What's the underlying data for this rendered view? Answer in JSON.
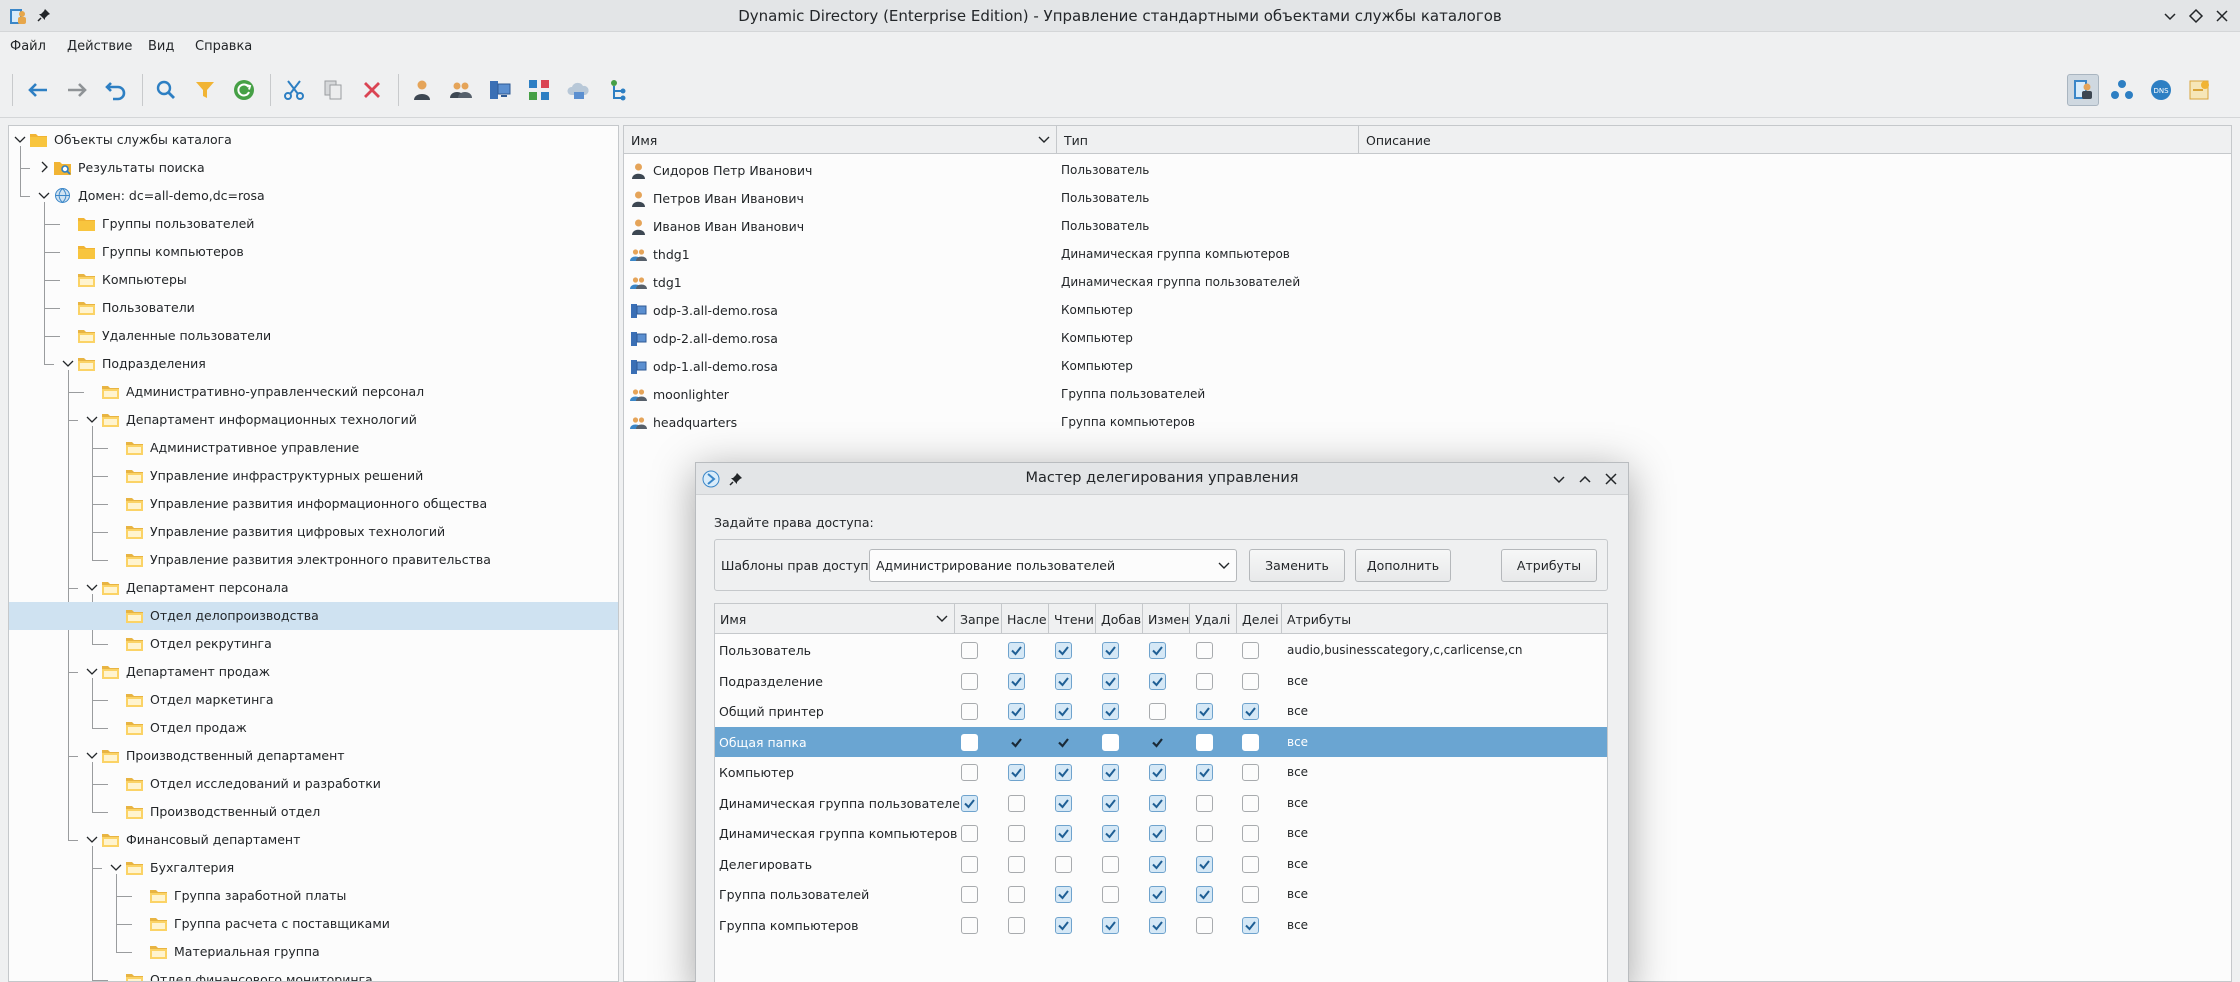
{
  "window": {
    "title": "Dynamic Directory (Enterprise Edition) - Управление стандартными объектами службы каталогов"
  },
  "menu": [
    "Файл",
    "Действие",
    "Вид",
    "Справка"
  ],
  "toolbar": {
    "left": [
      "back-arrow-icon",
      "forward-arrow-icon",
      "undo-icon",
      "search-icon",
      "filter-icon",
      "refresh-icon",
      "cut-icon",
      "copy-icon",
      "delete-icon",
      "user-icon",
      "group-icon",
      "computer-icon",
      "ou-icon",
      "cloud-icon",
      "tree-icon"
    ],
    "right": [
      "directory-view-icon",
      "network-icon",
      "dns-icon",
      "policy-icon"
    ],
    "accent": "#2d7fc3"
  },
  "tree": {
    "items": [
      {
        "label": "Объекты службы каталога",
        "level": 0,
        "expanded": true,
        "icon": "folder"
      },
      {
        "label": "Результаты поиска",
        "level": 1,
        "expanded": false,
        "icon": "search-folder"
      },
      {
        "label": "Домен: dc=all-demo,dc=rosa",
        "level": 1,
        "expanded": true,
        "icon": "domain"
      },
      {
        "label": "Группы пользователей",
        "level": 2,
        "icon": "folder"
      },
      {
        "label": "Группы компьютеров",
        "level": 2,
        "icon": "folder"
      },
      {
        "label": "Компьютеры",
        "level": 2,
        "icon": "ou"
      },
      {
        "label": "Пользователи",
        "level": 2,
        "icon": "ou"
      },
      {
        "label": "Удаленные пользователи",
        "level": 2,
        "icon": "ou"
      },
      {
        "label": "Подразделения",
        "level": 2,
        "expanded": true,
        "icon": "ou"
      },
      {
        "label": "Административно-управленческий персонал",
        "level": 3,
        "icon": "ou"
      },
      {
        "label": "Департамент информационных технологий",
        "level": 3,
        "expanded": true,
        "icon": "ou"
      },
      {
        "label": "Административное управление",
        "level": 4,
        "icon": "ou"
      },
      {
        "label": "Управление инфраструктурных решений",
        "level": 4,
        "icon": "ou"
      },
      {
        "label": "Управление развития информационного общества",
        "level": 4,
        "icon": "ou"
      },
      {
        "label": "Управление развития цифровых технологий",
        "level": 4,
        "icon": "ou"
      },
      {
        "label": "Управление развития электронного правительства",
        "level": 4,
        "icon": "ou"
      },
      {
        "label": "Департамент персонала",
        "level": 3,
        "expanded": true,
        "icon": "ou"
      },
      {
        "label": "Отдел делопроизводства",
        "level": 4,
        "icon": "ou",
        "selected": true
      },
      {
        "label": "Отдел рекрутинга",
        "level": 4,
        "icon": "ou"
      },
      {
        "label": "Департамент продаж",
        "level": 3,
        "expanded": true,
        "icon": "ou"
      },
      {
        "label": "Отдел маркетинга",
        "level": 4,
        "icon": "ou"
      },
      {
        "label": "Отдел продаж",
        "level": 4,
        "icon": "ou"
      },
      {
        "label": "Производственный департамент",
        "level": 3,
        "expanded": true,
        "icon": "ou"
      },
      {
        "label": "Отдел исследований и разработки",
        "level": 4,
        "icon": "ou"
      },
      {
        "label": "Производственный отдел",
        "level": 4,
        "icon": "ou"
      },
      {
        "label": "Финансовый департамент",
        "level": 3,
        "expanded": true,
        "icon": "ou"
      },
      {
        "label": "Бухгалтерия",
        "level": 4,
        "expanded": true,
        "icon": "ou"
      },
      {
        "label": "Группа заработной платы",
        "level": 5,
        "icon": "ou"
      },
      {
        "label": "Группа расчета с поставщиками",
        "level": 5,
        "icon": "ou"
      },
      {
        "label": "Материальная группа",
        "level": 5,
        "icon": "ou"
      },
      {
        "label": "Отдел финансового мониторинга",
        "level": 4,
        "icon": "ou"
      }
    ]
  },
  "list": {
    "columns": [
      "Имя",
      "Тип",
      "Описание"
    ],
    "rows": [
      {
        "name": "Сидоров Петр Иванович",
        "type": "Пользователь",
        "icon": "user"
      },
      {
        "name": "Петров Иван Иванович",
        "type": "Пользователь",
        "icon": "user"
      },
      {
        "name": "Иванов Иван Иванович",
        "type": "Пользователь",
        "icon": "user"
      },
      {
        "name": "thdg1",
        "type": "Динамическая группа компьютеров",
        "icon": "group"
      },
      {
        "name": "tdg1",
        "type": "Динамическая группа пользователей",
        "icon": "group"
      },
      {
        "name": "odp-3.all-demo.rosa",
        "type": "Компьютер",
        "icon": "computer"
      },
      {
        "name": "odp-2.all-demo.rosa",
        "type": "Компьютер",
        "icon": "computer"
      },
      {
        "name": "odp-1.all-demo.rosa",
        "type": "Компьютер",
        "icon": "computer"
      },
      {
        "name": "moonlighter",
        "type": "Группа пользователей",
        "icon": "group"
      },
      {
        "name": "headquarters",
        "type": "Группа компьютеров",
        "icon": "group"
      }
    ]
  },
  "dialog": {
    "title": "Мастер делегирования управления",
    "prompt": "Задайте права доступа:",
    "template_label": "Шаблоны прав доступа",
    "template_value": "Администрирование пользователей",
    "buttons": {
      "replace": "Заменить",
      "append": "Дополнить",
      "attributes": "Атрибуты"
    },
    "columns": [
      "Имя",
      "Запре",
      "Насле",
      "Чтени",
      "Добав",
      "Измен",
      "Удалі",
      "Делеі",
      "Атрибуты"
    ],
    "rows": [
      {
        "name": "Пользователь",
        "checks": [
          false,
          true,
          true,
          true,
          true,
          false,
          false
        ],
        "attrs": "audio,businesscategory,c,carlicense,cn"
      },
      {
        "name": "Подразделение",
        "checks": [
          false,
          true,
          true,
          true,
          true,
          false,
          false
        ],
        "attrs": "все"
      },
      {
        "name": "Общий принтер",
        "checks": [
          false,
          true,
          true,
          true,
          false,
          true,
          true
        ],
        "attrs": "все"
      },
      {
        "name": "Общая папка",
        "checks": [
          false,
          true,
          true,
          false,
          true,
          false,
          false
        ],
        "attrs": "все",
        "selected": true
      },
      {
        "name": "Компьютер",
        "checks": [
          false,
          true,
          true,
          true,
          true,
          true,
          false
        ],
        "attrs": "все"
      },
      {
        "name": "Динамическая группа пользователей",
        "checks": [
          true,
          false,
          true,
          true,
          true,
          false,
          false
        ],
        "attrs": "все"
      },
      {
        "name": "Динамическая группа компьютеров",
        "checks": [
          false,
          false,
          true,
          true,
          true,
          false,
          false
        ],
        "attrs": "все"
      },
      {
        "name": "Делегировать",
        "checks": [
          false,
          false,
          false,
          false,
          true,
          true,
          false
        ],
        "attrs": "все"
      },
      {
        "name": "Группа пользователей",
        "checks": [
          false,
          false,
          true,
          false,
          true,
          true,
          false
        ],
        "attrs": "все"
      },
      {
        "name": "Группа компьютеров",
        "checks": [
          false,
          false,
          true,
          true,
          true,
          false,
          true
        ],
        "attrs": "все"
      }
    ]
  }
}
